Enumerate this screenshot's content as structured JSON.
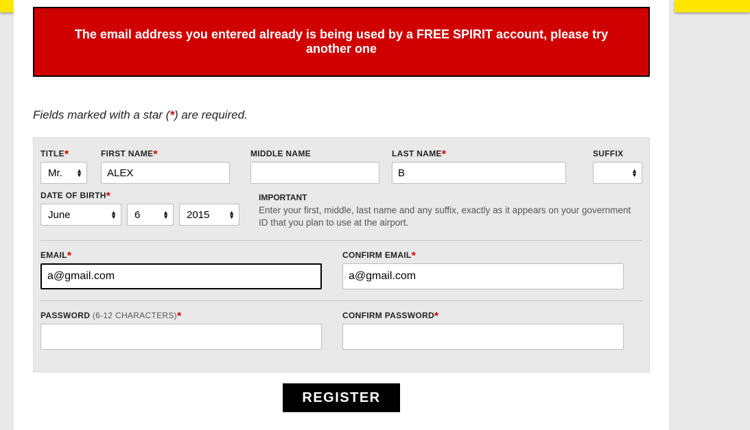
{
  "error_message": "The email address you entered already is being used by a FREE SPIRIT account, please try another one",
  "form_note_pre": "Fields marked with a star (",
  "form_note_star": "*",
  "form_note_post": ") are required.",
  "labels": {
    "title": "TITLE",
    "first_name": "FIRST NAME",
    "middle_name": "MIDDLE NAME",
    "last_name": "LAST NAME",
    "suffix": "SUFFIX",
    "dob": "DATE OF BIRTH",
    "important": "IMPORTANT",
    "important_text": "Enter your first, middle, last name and any suffix, exactly as it appears on your government ID that you plan to use at the airport.",
    "email": "EMAIL",
    "confirm_email": "CONFIRM EMAIL",
    "password": "PASSWORD ",
    "password_hint": "(6-12 CHARACTERS)",
    "confirm_password": "CONFIRM PASSWORD"
  },
  "values": {
    "title": "Mr.",
    "first_name": "ALEX",
    "middle_name": "",
    "last_name": "B",
    "suffix": "",
    "month": "June",
    "day": "6",
    "year": "2015",
    "email": "a@gmail.com",
    "confirm_email": "a@gmail.com",
    "password": "",
    "confirm_password": ""
  },
  "buttons": {
    "register": "REGISTER"
  }
}
